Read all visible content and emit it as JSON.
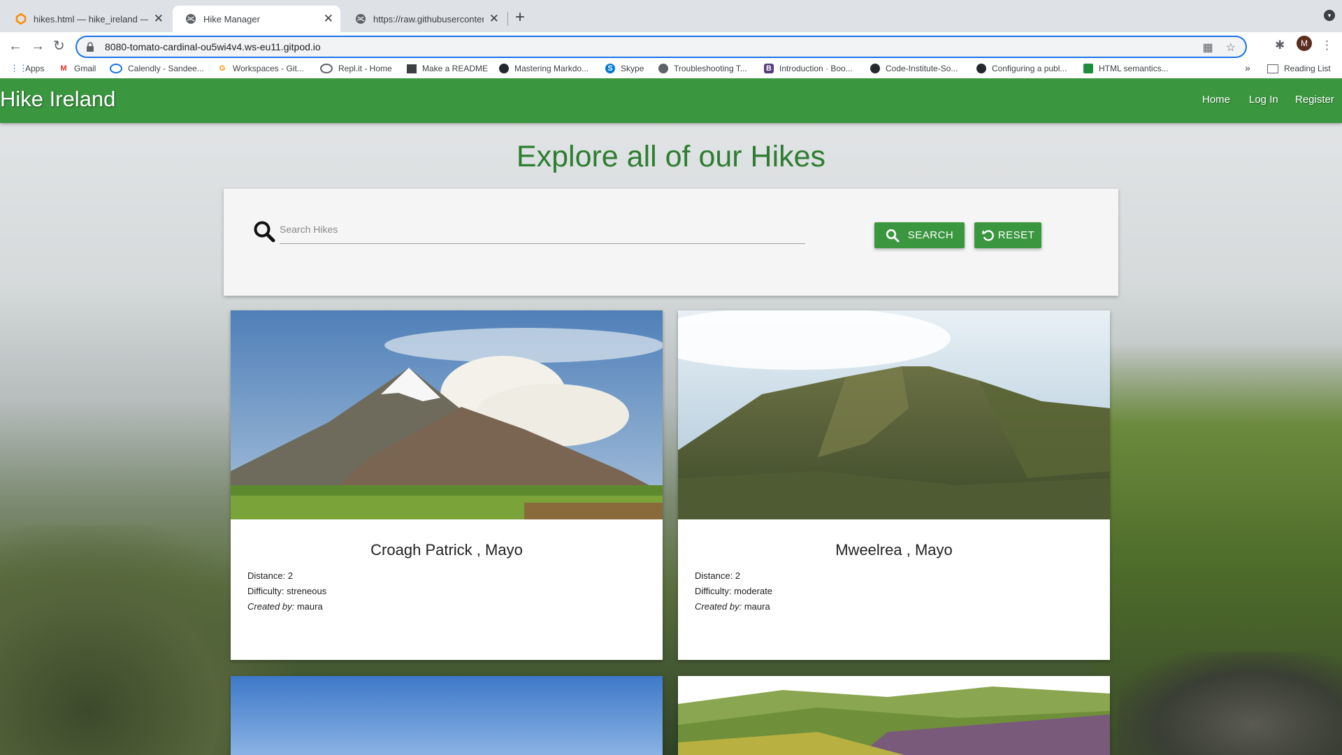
{
  "browser": {
    "tabs": [
      {
        "title": "hikes.html — hike_ireland — Gi",
        "active": false
      },
      {
        "title": "Hike Manager",
        "active": true
      },
      {
        "title": "https://raw.githubusercontent.c",
        "active": false
      }
    ],
    "url": "8080-tomato-cardinal-ou5wi4v4.ws-eu11.gitpod.io",
    "profile_initial": "M",
    "bookmarks": [
      {
        "label": "Apps",
        "icon": "apps-grid-icon"
      },
      {
        "label": "Gmail",
        "icon": "gmail-icon"
      },
      {
        "label": "Calendly - Sandee...",
        "icon": "calendly-icon"
      },
      {
        "label": "Workspaces - Git...",
        "icon": "gitpod-icon"
      },
      {
        "label": "Repl.it - Home",
        "icon": "replit-icon"
      },
      {
        "label": "Make a README",
        "icon": "document-icon"
      },
      {
        "label": "Mastering Markdo...",
        "icon": "github-icon"
      },
      {
        "label": "Skype",
        "icon": "skype-icon"
      },
      {
        "label": "Troubleshooting T...",
        "icon": "globe-icon"
      },
      {
        "label": "Introduction · Boo...",
        "icon": "bootstrap-icon"
      },
      {
        "label": "Code-Institute-So...",
        "icon": "github-icon"
      },
      {
        "label": "Configuring a publ...",
        "icon": "github-icon"
      },
      {
        "label": "HTML semantics...",
        "icon": "image-icon"
      }
    ],
    "overflow_label": "»",
    "reading_list": "Reading List"
  },
  "site": {
    "brand": "Hike Ireland",
    "nav": [
      "Home",
      "Log In",
      "Register"
    ],
    "heading": "Explore all of our Hikes",
    "search": {
      "placeholder": "Search Hikes",
      "search_label": "SEARCH",
      "reset_label": "RESET"
    },
    "labels": {
      "distance": "Distance: ",
      "difficulty": "Difficulty: ",
      "created_by": "Created by:"
    },
    "hikes": [
      {
        "name": "Croagh Patrick , Mayo",
        "distance": "2",
        "difficulty": "streneous",
        "created_by": "maura"
      },
      {
        "name": "Mweelrea , Mayo",
        "distance": "2",
        "difficulty": "moderate",
        "created_by": "maura"
      }
    ]
  },
  "colors": {
    "brand_green": "#3a963f",
    "heading_green": "#2e7d32"
  }
}
